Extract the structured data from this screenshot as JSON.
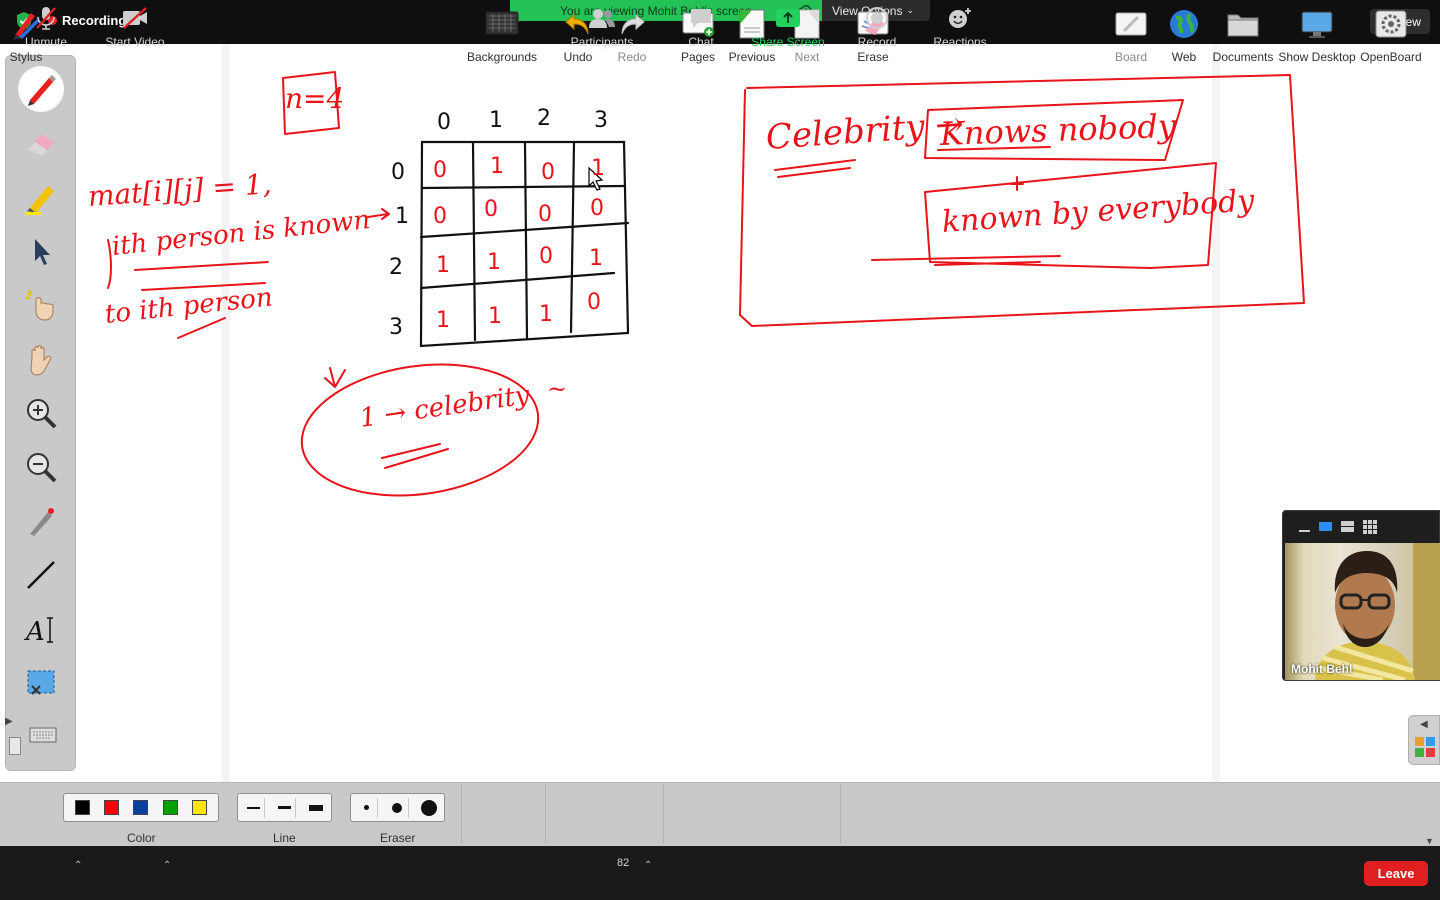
{
  "topbar": {
    "recording_label": "Recording",
    "viewing_banner": "You are viewing Mohit Behl's screen",
    "view_options_label": "View Options",
    "view_button_label": "View"
  },
  "whiteboard": {
    "toolbar": {
      "stylus_label": "Stylus",
      "color_label": "Color",
      "line_label": "Line",
      "eraser_label": "Eraser",
      "backgrounds_label": "Backgrounds",
      "undo_label": "Undo",
      "redo_label": "Redo",
      "pages_label": "Pages",
      "previous_label": "Previous",
      "next_label": "Next",
      "erase_label": "Erase",
      "board_label": "Board",
      "web_label": "Web",
      "documents_label": "Documents",
      "show_desktop_label": "Show Desktop",
      "openboard_label": "OpenBoard"
    },
    "colors": [
      "#000000",
      "#ff0000",
      "#0a3f9a",
      "#00a000",
      "#ffe600"
    ],
    "ink_color": "#e8141a"
  },
  "controls": {
    "unmute_label": "Unmute",
    "start_video_label": "Start Video",
    "participants_label": "Participants",
    "participants_count": "82",
    "chat_label": "Chat",
    "share_screen_label": "Share Screen",
    "record_label": "Record",
    "reactions_label": "Reactions",
    "leave_label": "Leave"
  },
  "video": {
    "participant_name": "Mohit Behl"
  },
  "handwriting": {
    "n_label": "n=4",
    "col_headers": [
      "0",
      "1",
      "2",
      "3"
    ],
    "row_headers": [
      "0",
      "1",
      "2",
      "3"
    ],
    "matrix": [
      [
        "0",
        "1",
        "0",
        "1"
      ],
      [
        "0",
        "0",
        "0",
        "0"
      ],
      [
        "1",
        "1",
        "0",
        "1"
      ],
      [
        "1",
        "1",
        "1",
        "0"
      ]
    ],
    "def_line1": "mat[i][j] = 1,",
    "def_line2": "ith person is known",
    "def_line3": "to ith person",
    "result_note": "1 → celebrity",
    "result_side_mark": "~",
    "celebrity_word": "Celebrity →",
    "knows_nobody": "Knows nobody",
    "plus_sign": "+",
    "known_by_everybody": "known by everybody"
  }
}
